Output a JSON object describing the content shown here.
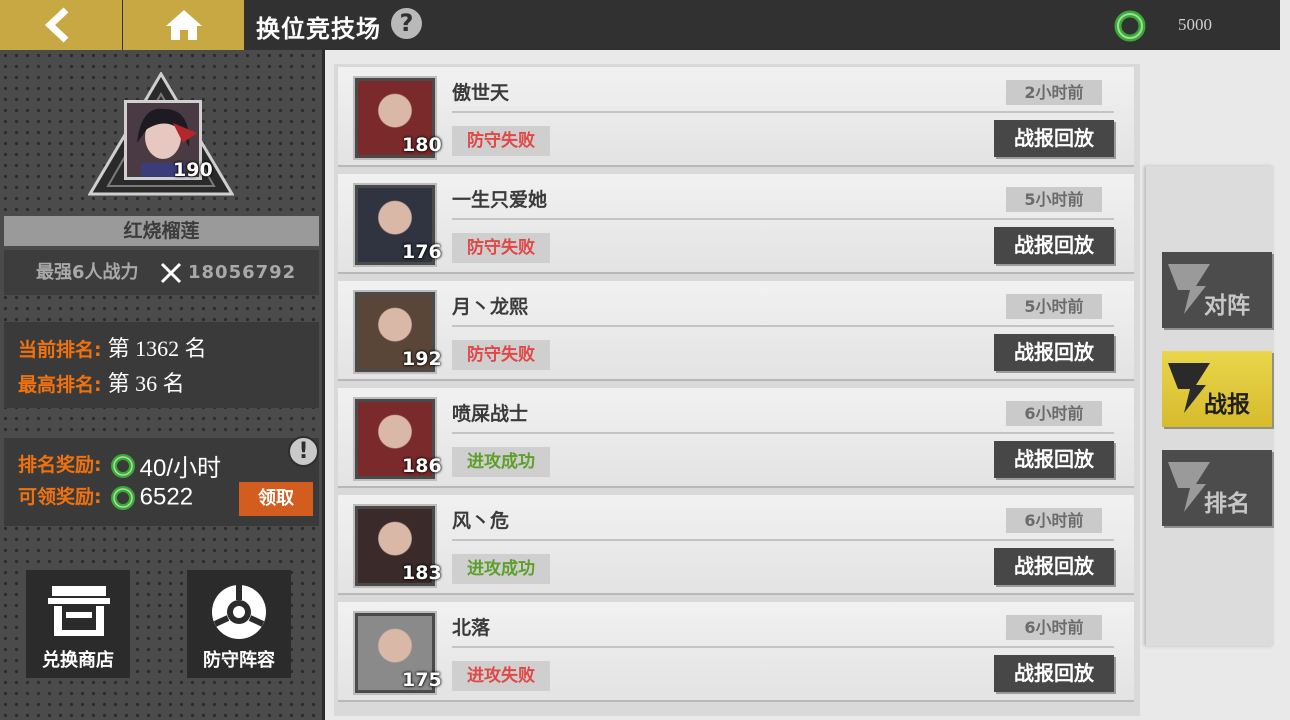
{
  "header": {
    "title": "换位竞技场",
    "currency_value": "5000",
    "help_label": "?"
  },
  "player": {
    "name": "红烧榴莲",
    "level": "190",
    "power_label": "最强6人战力",
    "power_value": "18056792",
    "current_rank_label": "当前排名:",
    "current_rank_value": "第 1362 名",
    "best_rank_label": "最高排名:",
    "best_rank_value": "第 36 名",
    "rank_reward_label": "排名奖励:",
    "rank_reward_value": "40/小时",
    "claimable_label": "可领奖励:",
    "claimable_value": "6522",
    "claim_button": "领取",
    "alert_label": "!"
  },
  "buttons": {
    "shop": "兑换商店",
    "defense": "防守阵容"
  },
  "records": [
    {
      "name": "傲世天",
      "level": "180",
      "time": "2小时前",
      "result": "防守失败",
      "result_type": "fail",
      "replay": "战报回放",
      "portrait_color": "#7a2a2a"
    },
    {
      "name": "一生只爱她",
      "level": "176",
      "time": "5小时前",
      "result": "防守失败",
      "result_type": "fail",
      "replay": "战报回放",
      "portrait_color": "#2f3440"
    },
    {
      "name": "月丶龙熙",
      "level": "192",
      "time": "5小时前",
      "result": "防守失败",
      "result_type": "fail",
      "replay": "战报回放",
      "portrait_color": "#5a4638"
    },
    {
      "name": "喷屎战士",
      "level": "186",
      "time": "6小时前",
      "result": "进攻成功",
      "result_type": "win",
      "replay": "战报回放",
      "portrait_color": "#7a2a2a"
    },
    {
      "name": "风丶危",
      "level": "183",
      "time": "6小时前",
      "result": "进攻成功",
      "result_type": "win",
      "replay": "战报回放",
      "portrait_color": "#3a2a2a"
    },
    {
      "name": "北落",
      "level": "175",
      "time": "6小时前",
      "result": "进攻失败",
      "result_type": "fail",
      "replay": "战报回放",
      "portrait_color": "#8a8a8a"
    }
  ],
  "tabs": [
    {
      "label": "对阵",
      "active": false
    },
    {
      "label": "战报",
      "active": true
    },
    {
      "label": "排名",
      "active": false
    }
  ],
  "colors": {
    "accent_gold": "#c8a843",
    "rank_orange": "#f0720f",
    "fail_red": "#e04848",
    "win_green": "#5e9e2a",
    "claim_orange": "#d25d1f"
  }
}
